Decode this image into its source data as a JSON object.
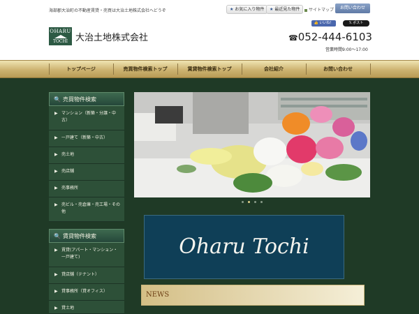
{
  "header": {
    "tagline": "海部郡大治町の不動産賃貸・売買は大治土地株式会社へどうぞ",
    "favorites_label": "お気に入り物件",
    "recent_label": "最近見た物件",
    "sitemap_label": "サイトマップ",
    "contact_label": "お問い合わせ",
    "logo_line1": "OHARU",
    "logo_line2": "TOCHI",
    "company_name": "大治土地株式会社",
    "like_label": "いいね！",
    "post_label": "ポスト",
    "phone": "052-444-6103",
    "hours": "営業時間9:00～17:00"
  },
  "nav": {
    "items": [
      {
        "label": "トップページ"
      },
      {
        "label": "売買物件検索トップ"
      },
      {
        "label": "賃貸物件検索トップ"
      },
      {
        "label": "会社紹介"
      },
      {
        "label": "お問い合わせ"
      }
    ]
  },
  "sidebar": {
    "sale_heading": "売買物件検索",
    "sale_items": [
      {
        "label": "マンション（新築・分譲・中古）"
      },
      {
        "label": "一戸建て（新築・中古）"
      },
      {
        "label": "売土地"
      },
      {
        "label": "売店舗"
      },
      {
        "label": "売事務所"
      },
      {
        "label": "売ビル・売倉庫・売工場・その他"
      }
    ],
    "rent_heading": "賃貸物件検索",
    "rent_items": [
      {
        "label": "賃貸(アパート・マンション・一戸建て)"
      },
      {
        "label": "貸店舗（テナント）"
      },
      {
        "label": "貸事務所（貸オフィス）"
      },
      {
        "label": "貸土地"
      }
    ]
  },
  "main": {
    "banner_text": "Oharu Tochi",
    "news_label": "NEWS",
    "slide_count": 4,
    "active_slide": 2
  },
  "colors": {
    "background": "#1f3a26",
    "nav_gold": "#cdb371",
    "banner_blue": "#0f3f57",
    "sidebar_green": "#2d5038"
  }
}
